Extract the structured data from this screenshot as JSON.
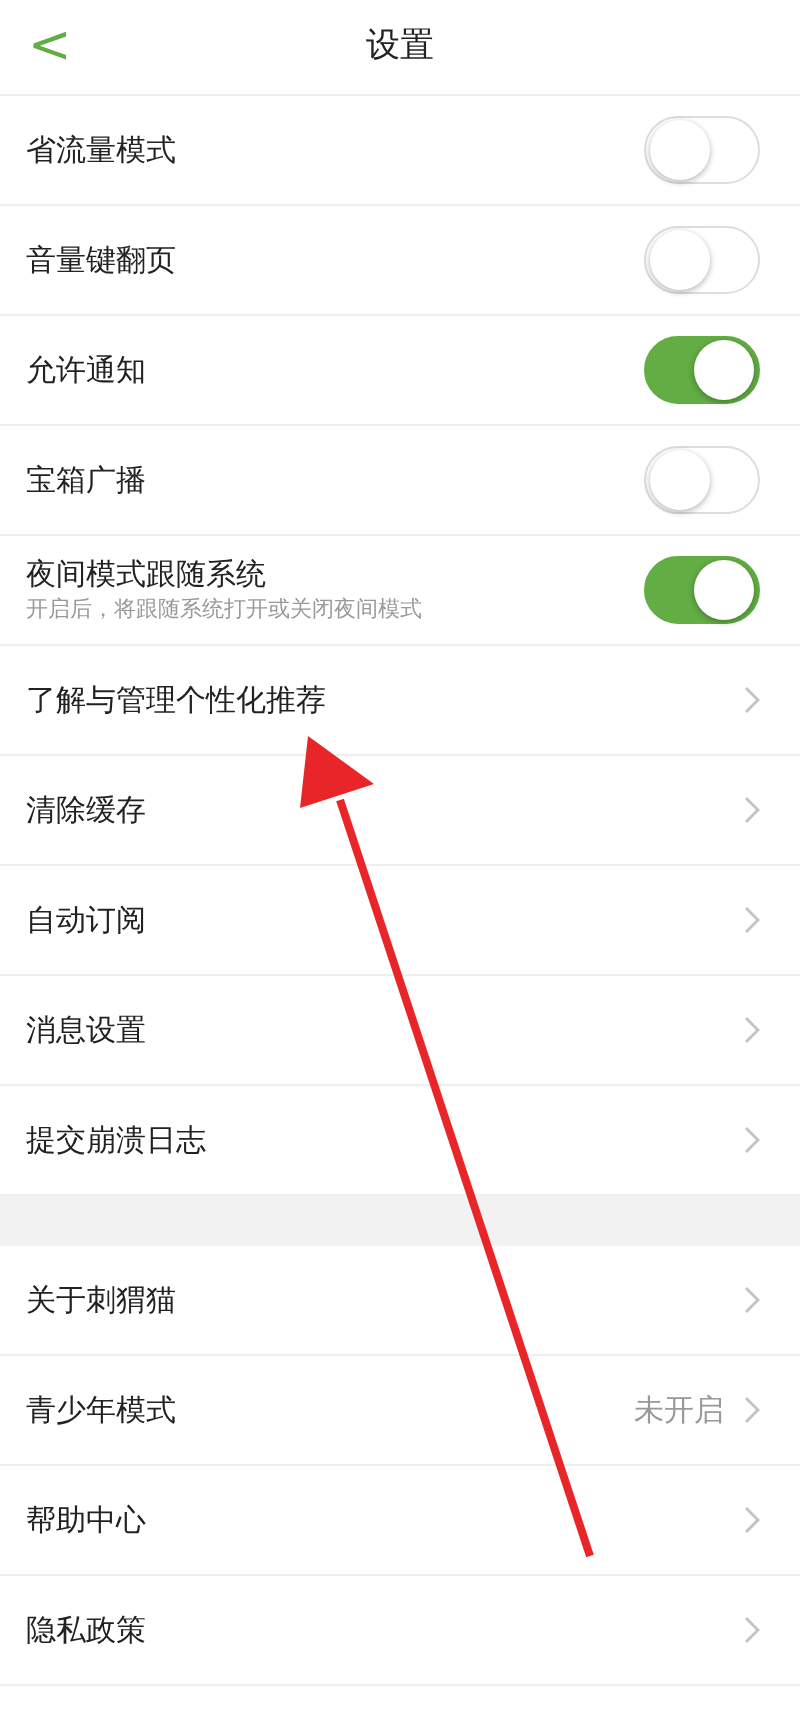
{
  "header": {
    "back_icon": "<",
    "title": "设置"
  },
  "sections": [
    {
      "items": [
        {
          "kind": "toggle",
          "label": "省流量模式",
          "on": false
        },
        {
          "kind": "toggle",
          "label": "音量键翻页",
          "on": false
        },
        {
          "kind": "toggle",
          "label": "允许通知",
          "on": true
        },
        {
          "kind": "toggle",
          "label": "宝箱广播",
          "on": false
        },
        {
          "kind": "toggle",
          "label": "夜间模式跟随系统",
          "subtitle": "开启后，将跟随系统打开或关闭夜间模式",
          "on": true
        },
        {
          "kind": "link",
          "label": "了解与管理个性化推荐"
        },
        {
          "kind": "link",
          "label": "清除缓存"
        },
        {
          "kind": "link",
          "label": "自动订阅"
        },
        {
          "kind": "link",
          "label": "消息设置"
        },
        {
          "kind": "link",
          "label": "提交崩溃日志"
        }
      ]
    },
    {
      "items": [
        {
          "kind": "link",
          "label": "关于刺猬猫"
        },
        {
          "kind": "link",
          "label": "青少年模式",
          "value": "未开启"
        },
        {
          "kind": "link",
          "label": "帮助中心"
        },
        {
          "kind": "link",
          "label": "隐私政策"
        }
      ]
    }
  ]
}
